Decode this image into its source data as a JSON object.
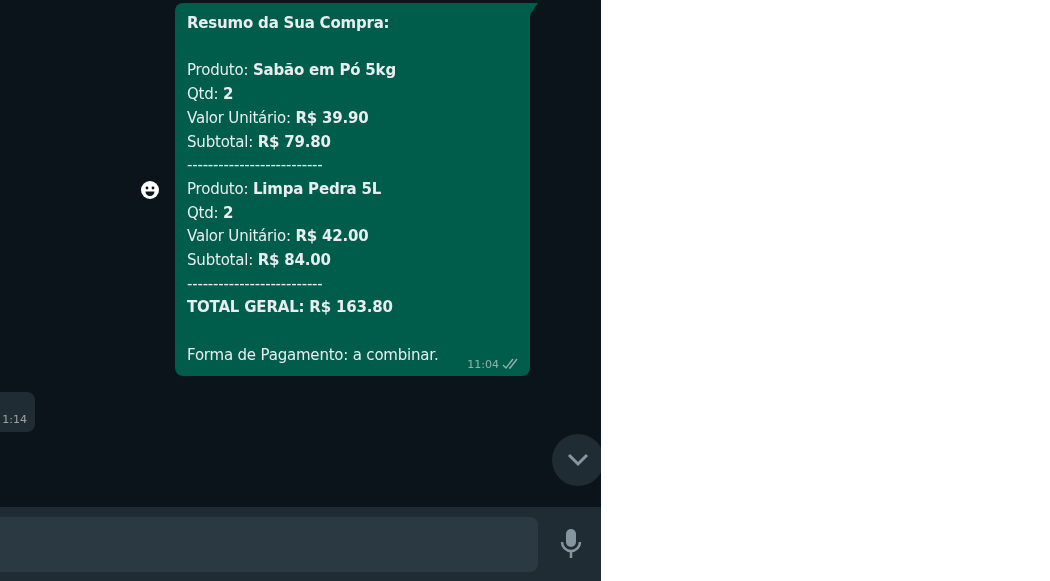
{
  "chat": {
    "messages": [
      {
        "kind": "outgoing",
        "reacted": true,
        "paragraphs": [
          [
            {
              "text": "Resumo da Sua Compra:",
              "bold": true
            }
          ],
          [
            {
              "text": "Produto: **Sabão em Pó 5kg**",
              "bold": false
            },
            {
              "text": "Qtd: **2**",
              "bold": false
            },
            {
              "text": "Valor Unitário: **R$ 39.90**",
              "bold": false
            },
            {
              "text": "Subtotal: **R$ 79.80**",
              "bold": false
            },
            {
              "text": "--------------------------",
              "bold": false
            },
            {
              "text": "Produto: **Limpa Pedra 5L**",
              "bold": false
            },
            {
              "text": "Qtd: **2**",
              "bold": false
            },
            {
              "text": "Valor Unitário: **R$ 42.00**",
              "bold": false
            },
            {
              "text": "Subtotal: **R$ 84.00**",
              "bold": false
            },
            {
              "text": "--------------------------",
              "bold": false
            },
            {
              "text": "TOTAL GERAL: R$ 163.80",
              "bold": true
            }
          ],
          [
            {
              "text": "Forma de Pagamento: a combinar.",
              "bold": false
            }
          ]
        ],
        "time": "11:04",
        "read": false
      },
      {
        "kind": "incoming",
        "time": "1:14"
      }
    ]
  }
}
